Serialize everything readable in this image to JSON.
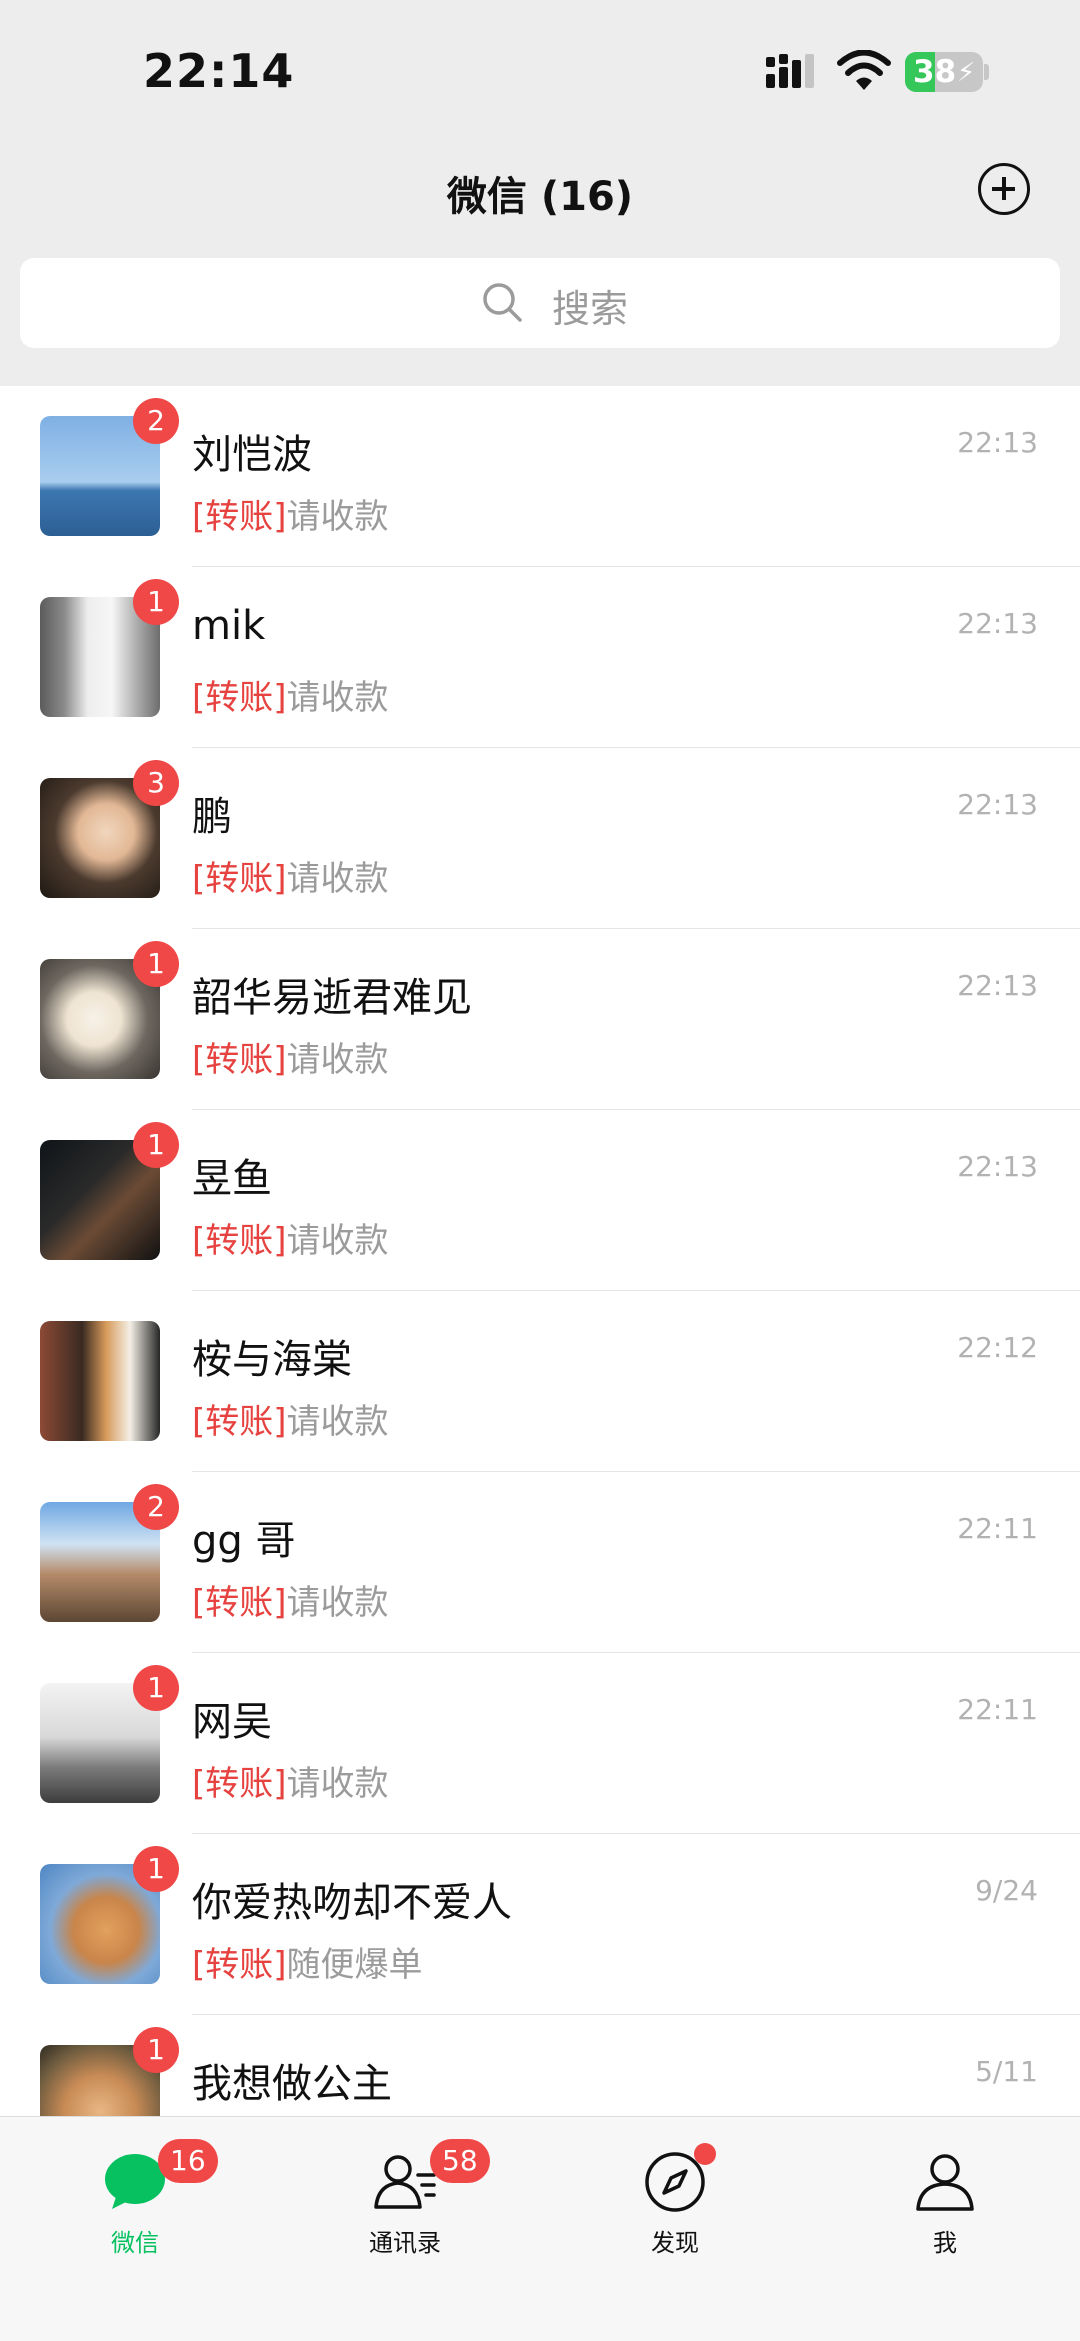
{
  "status_bar": {
    "time": "22:14",
    "battery_level": "38"
  },
  "header": {
    "title": "微信 (16)",
    "search_placeholder": "搜索"
  },
  "chats": [
    {
      "name": "刘恺波",
      "time": "22:13",
      "badge": "2",
      "preview_tag": "[转账]",
      "preview_text": "请收款"
    },
    {
      "name": "mik",
      "time": "22:13",
      "badge": "1",
      "preview_tag": "[转账]",
      "preview_text": "请收款"
    },
    {
      "name": "鹏",
      "time": "22:13",
      "badge": "3",
      "preview_tag": "[转账]",
      "preview_text": "请收款"
    },
    {
      "name": "韶华易逝君难见",
      "time": "22:13",
      "badge": "1",
      "preview_tag": "[转账]",
      "preview_text": "请收款"
    },
    {
      "name": "昱鱼",
      "time": "22:13",
      "badge": "1",
      "preview_tag": "[转账]",
      "preview_text": "请收款"
    },
    {
      "name": "桉与海棠",
      "time": "22:12",
      "badge": "",
      "preview_tag": "[转账]",
      "preview_text": "请收款"
    },
    {
      "name": "gg 哥",
      "time": "22:11",
      "badge": "2",
      "preview_tag": "[转账]",
      "preview_text": "请收款"
    },
    {
      "name": "网吴",
      "time": "22:11",
      "badge": "1",
      "preview_tag": "[转账]",
      "preview_text": "请收款"
    },
    {
      "name": "你爱热吻却不爱人",
      "time": "9/24",
      "badge": "1",
      "preview_tag": "[转账]",
      "preview_text": "随便爆单"
    },
    {
      "name": "我想做公主",
      "time": "5/11",
      "badge": "1",
      "preview_tag": "",
      "preview_text": ""
    }
  ],
  "tabs": [
    {
      "label": "微信",
      "badge": "16",
      "active": true,
      "icon": "chat-bubble-icon"
    },
    {
      "label": "通讯录",
      "badge": "58",
      "active": false,
      "icon": "contacts-icon"
    },
    {
      "label": "发现",
      "badge": "",
      "active": false,
      "icon": "compass-icon"
    },
    {
      "label": "我",
      "badge": "",
      "active": false,
      "icon": "person-icon"
    }
  ],
  "colors": {
    "accent": "#07c160",
    "badge": "#f04747",
    "transfer_tag": "#e64340"
  }
}
